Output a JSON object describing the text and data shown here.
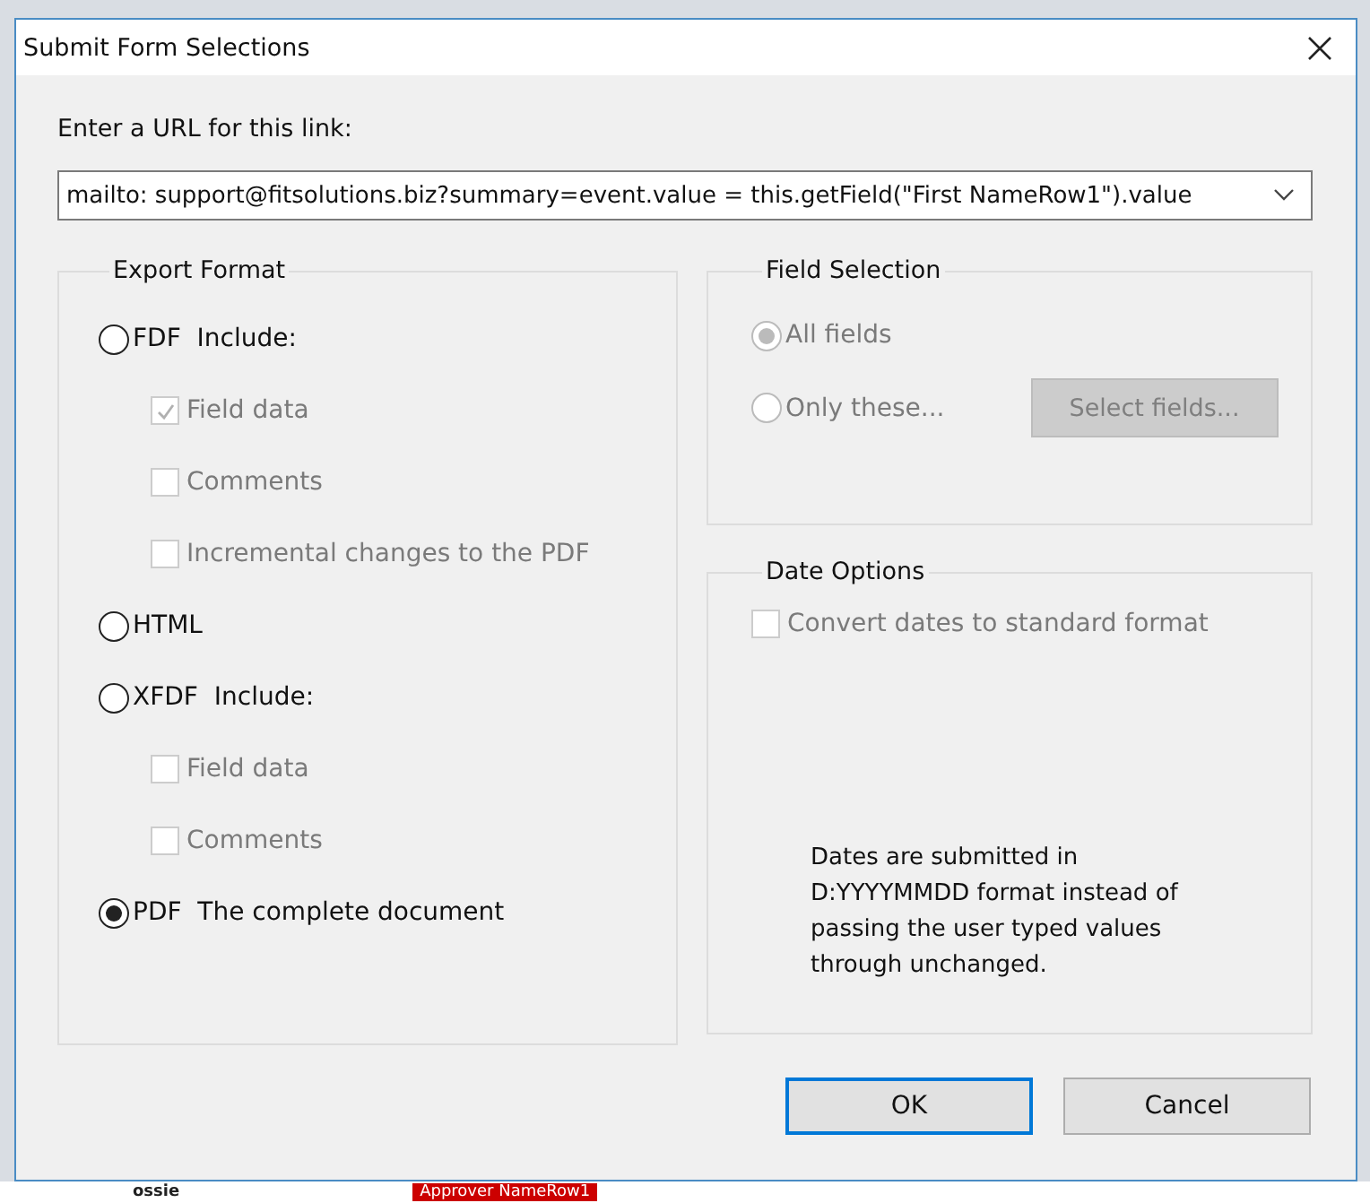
{
  "window": {
    "title": "Submit Form Selections",
    "close": true
  },
  "url": {
    "label": "Enter a URL for this link:",
    "value": "mailto: support@fitsolutions.biz?summary=event.value = this.getField(\"First NameRow1\").value"
  },
  "export_format": {
    "title": "Export Format",
    "options": [
      {
        "label": "FDF  Include:",
        "selected": false,
        "children": [
          {
            "label": "Field data",
            "checked": true,
            "disabled": true
          },
          {
            "label": "Comments",
            "checked": false,
            "disabled": true
          },
          {
            "label": "Incremental changes to the PDF",
            "checked": false,
            "disabled": true
          }
        ]
      },
      {
        "label": "HTML",
        "selected": false
      },
      {
        "label": "XFDF  Include:",
        "selected": false,
        "children": [
          {
            "label": "Field data",
            "checked": false,
            "disabled": true
          },
          {
            "label": "Comments",
            "checked": false,
            "disabled": true
          }
        ]
      },
      {
        "label": "PDF  The complete document",
        "selected": true
      }
    ]
  },
  "field_selection": {
    "title": "Field Selection",
    "options": [
      {
        "label": "All fields",
        "selected": true,
        "disabled": true
      },
      {
        "label": "Only these...",
        "selected": false,
        "disabled": true
      }
    ],
    "button": {
      "label": "Select fields...",
      "disabled": true
    }
  },
  "date_options": {
    "title": "Date Options",
    "checkbox": {
      "label": "Convert dates to standard format",
      "checked": false,
      "disabled": true
    },
    "note": "Dates are submitted in D:YYYYMMDD format instead of passing the user typed values through unchanged."
  },
  "buttons": [
    {
      "label": "OK",
      "default": true
    },
    {
      "label": "Cancel",
      "default": false
    }
  ],
  "background": [
    "ossie",
    "Approver NameRow1"
  ]
}
